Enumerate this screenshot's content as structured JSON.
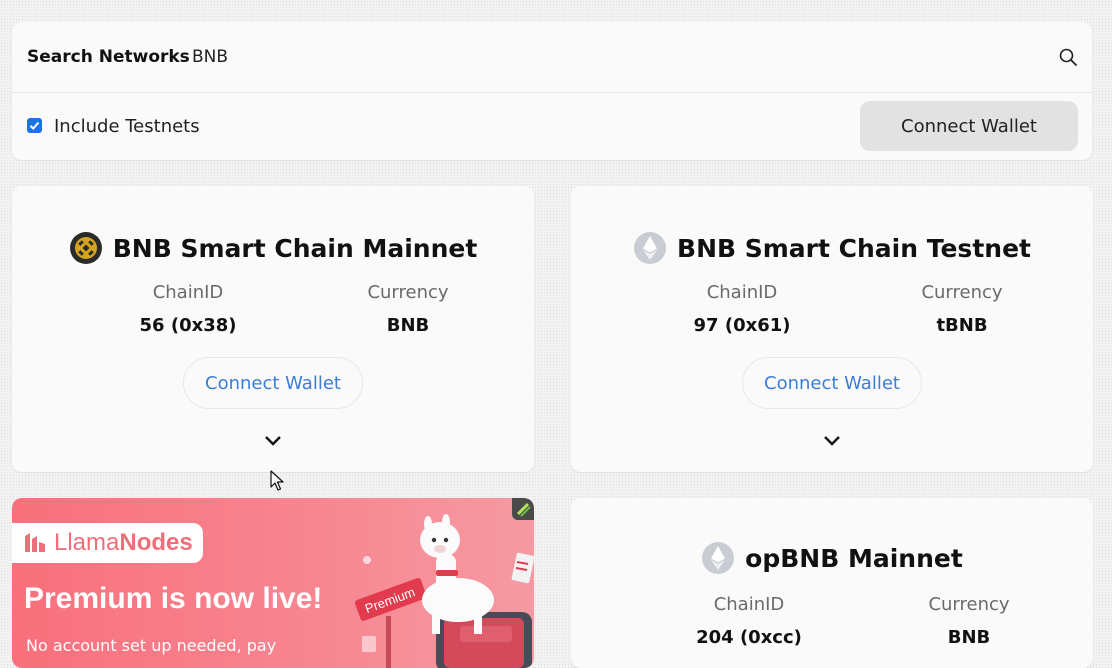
{
  "search": {
    "label": "Search Networks",
    "value": "BNB",
    "icon": "search-icon"
  },
  "filters": {
    "include_testnets_label": "Include Testnets",
    "include_testnets_checked": true,
    "connect_label": "Connect Wallet"
  },
  "cards": [
    {
      "name": "BNB Smart Chain Mainnet",
      "icon": "bnb-chain-icon",
      "chainid_label": "ChainID",
      "chainid_value": "56 (0x38)",
      "currency_label": "Currency",
      "currency_value": "BNB",
      "connect_label": "Connect Wallet"
    },
    {
      "name": "BNB Smart Chain Testnet",
      "icon": "ethereum-icon",
      "chainid_label": "ChainID",
      "chainid_value": "97 (0x61)",
      "currency_label": "Currency",
      "currency_value": "tBNB",
      "connect_label": "Connect Wallet"
    },
    {
      "name": "opBNB Mainnet",
      "icon": "ethereum-icon",
      "chainid_label": "ChainID",
      "chainid_value": "204 (0xcc)",
      "currency_label": "Currency",
      "currency_value": "BNB"
    }
  ],
  "ad": {
    "brand_regular": "Llama",
    "brand_bold": "Nodes",
    "headline": "Premium is now live!",
    "subtext": "No account set up needed, pay",
    "sign_text": "Premium"
  },
  "colors": {
    "accent": "#3b7dd8",
    "checkbox": "#1a73e8",
    "ad_background": "#f8707c"
  }
}
